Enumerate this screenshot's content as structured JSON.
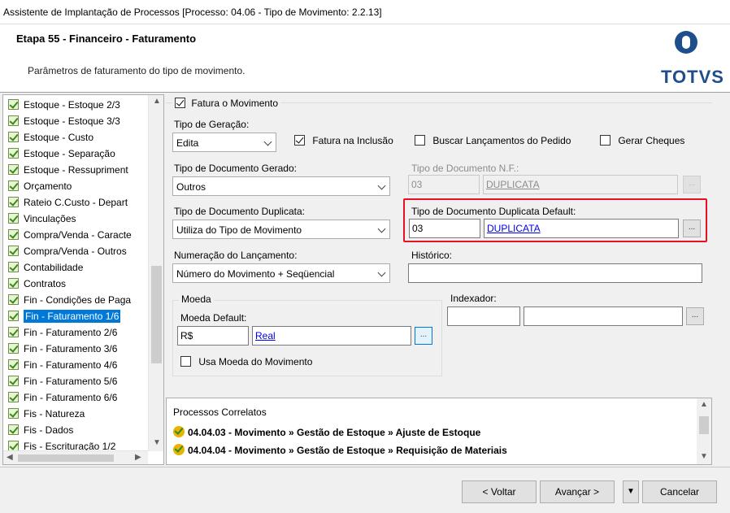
{
  "window": {
    "title": "Assistente de Implantação de Processos [Processo: 04.06 - Tipo de Movimento: 2.2.13]"
  },
  "header": {
    "step_title": "Etapa 55 - Financeiro - Faturamento",
    "step_description": "Parâmetros de faturamento do tipo de movimento.",
    "logo_text": "TOTVS",
    "logo_color": "#1f4e8c"
  },
  "tree": {
    "items": [
      {
        "label": "Estoque - Estoque 2/3"
      },
      {
        "label": "Estoque - Estoque 3/3"
      },
      {
        "label": "Estoque - Custo"
      },
      {
        "label": "Estoque - Separação"
      },
      {
        "label": "Estoque - Ressupriment"
      },
      {
        "label": "Orçamento"
      },
      {
        "label": "Rateio C.Custo - Depart"
      },
      {
        "label": "Vinculações"
      },
      {
        "label": "Compra/Venda - Caracte"
      },
      {
        "label": "Compra/Venda - Outros"
      },
      {
        "label": "Contabilidade"
      },
      {
        "label": "Contratos"
      },
      {
        "label": "Fin - Condições de Paga"
      },
      {
        "label": "Fin - Faturamento 1/6",
        "selected": true
      },
      {
        "label": "Fin - Faturamento 2/6"
      },
      {
        "label": "Fin - Faturamento 3/6"
      },
      {
        "label": "Fin - Faturamento 4/6"
      },
      {
        "label": "Fin - Faturamento 5/6"
      },
      {
        "label": "Fin - Faturamento 6/6"
      },
      {
        "label": "Fis - Natureza"
      },
      {
        "label": "Fis - Dados"
      },
      {
        "label": "Fis - Escrituração 1/2"
      }
    ],
    "selected_color": "#0078d7"
  },
  "form": {
    "fatura_movimento": {
      "label": "Fatura o Movimento",
      "checked": true
    },
    "tipo_geracao": {
      "label": "Tipo de Geração:",
      "value": "Edita"
    },
    "fatura_inclusao": {
      "label": "Fatura na Inclusão",
      "checked": true
    },
    "buscar_lancamentos": {
      "label": "Buscar Lançamentos do Pedido",
      "checked": false
    },
    "gerar_cheques": {
      "label": "Gerar Cheques",
      "checked": false
    },
    "tipo_doc_gerado": {
      "label": "Tipo de Documento Gerado:",
      "value": "Outros"
    },
    "tipo_doc_nf": {
      "label": "Tipo de Documento N.F.:",
      "code": "03",
      "name": "DUPLICATA"
    },
    "tipo_doc_duplicata": {
      "label": "Tipo de Documento Duplicata:",
      "value": "Utiliza do Tipo de Movimento"
    },
    "tipo_doc_dup_default": {
      "label": "Tipo de Documento Duplicata Default:",
      "code": "03",
      "name": "DUPLICATA"
    },
    "numeracao": {
      "label": "Numeração do Lançamento:",
      "value": "Número do Movimento + Seqüencial"
    },
    "historico": {
      "label": "Histórico:",
      "value": ""
    },
    "moeda_group": {
      "label": "Moeda"
    },
    "moeda_default": {
      "label": "Moeda Default:",
      "code": "R$",
      "name": "Real"
    },
    "usa_moeda": {
      "label": "Usa Moeda do Movimento",
      "checked": false
    },
    "indexador": {
      "label": "Indexador:",
      "code": "",
      "name": ""
    },
    "lookup_button": "...",
    "highlight_color": "#e81123"
  },
  "correlatos": {
    "title": "Processos Correlatos",
    "items": [
      "04.04.03 - Movimento » Gestão de Estoque » Ajuste de Estoque",
      "04.04.04 - Movimento » Gestão de Estoque » Requisição de Materiais"
    ]
  },
  "footer": {
    "back_label": "< Voltar",
    "next_label": "Avançar >",
    "dropdown_arrow": "▼",
    "cancel_label": "Cancelar"
  }
}
